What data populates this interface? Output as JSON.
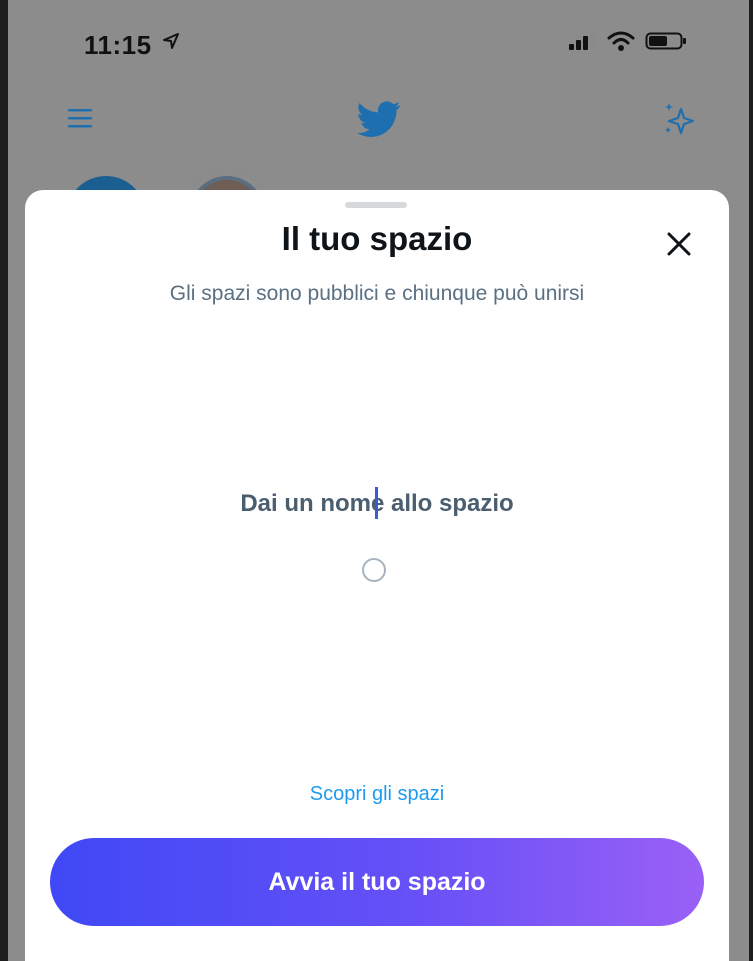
{
  "status_bar": {
    "time": "11:15"
  },
  "sheet": {
    "title": "Il tuo spazio",
    "subtitle": "Gli spazi sono pubblici e chiunque può unirsi",
    "name_placeholder": "Dai un nome allo spazio",
    "discover_link": "Scopri gli spazi",
    "start_button": "Avvia il tuo spazio"
  },
  "colors": {
    "accent_link": "#1d9bf0",
    "button_gradient_start": "#3f49f5",
    "button_gradient_end": "#9a60f6",
    "twitter_blue": "#1d6fb0"
  },
  "icons": {
    "location": "location-arrow-icon",
    "signal": "cellular-signal-icon",
    "wifi": "wifi-icon",
    "battery": "battery-icon",
    "menu": "hamburger-menu-icon",
    "logo": "twitter-bird-icon",
    "sparkle": "sparkle-icon",
    "close": "close-icon"
  }
}
